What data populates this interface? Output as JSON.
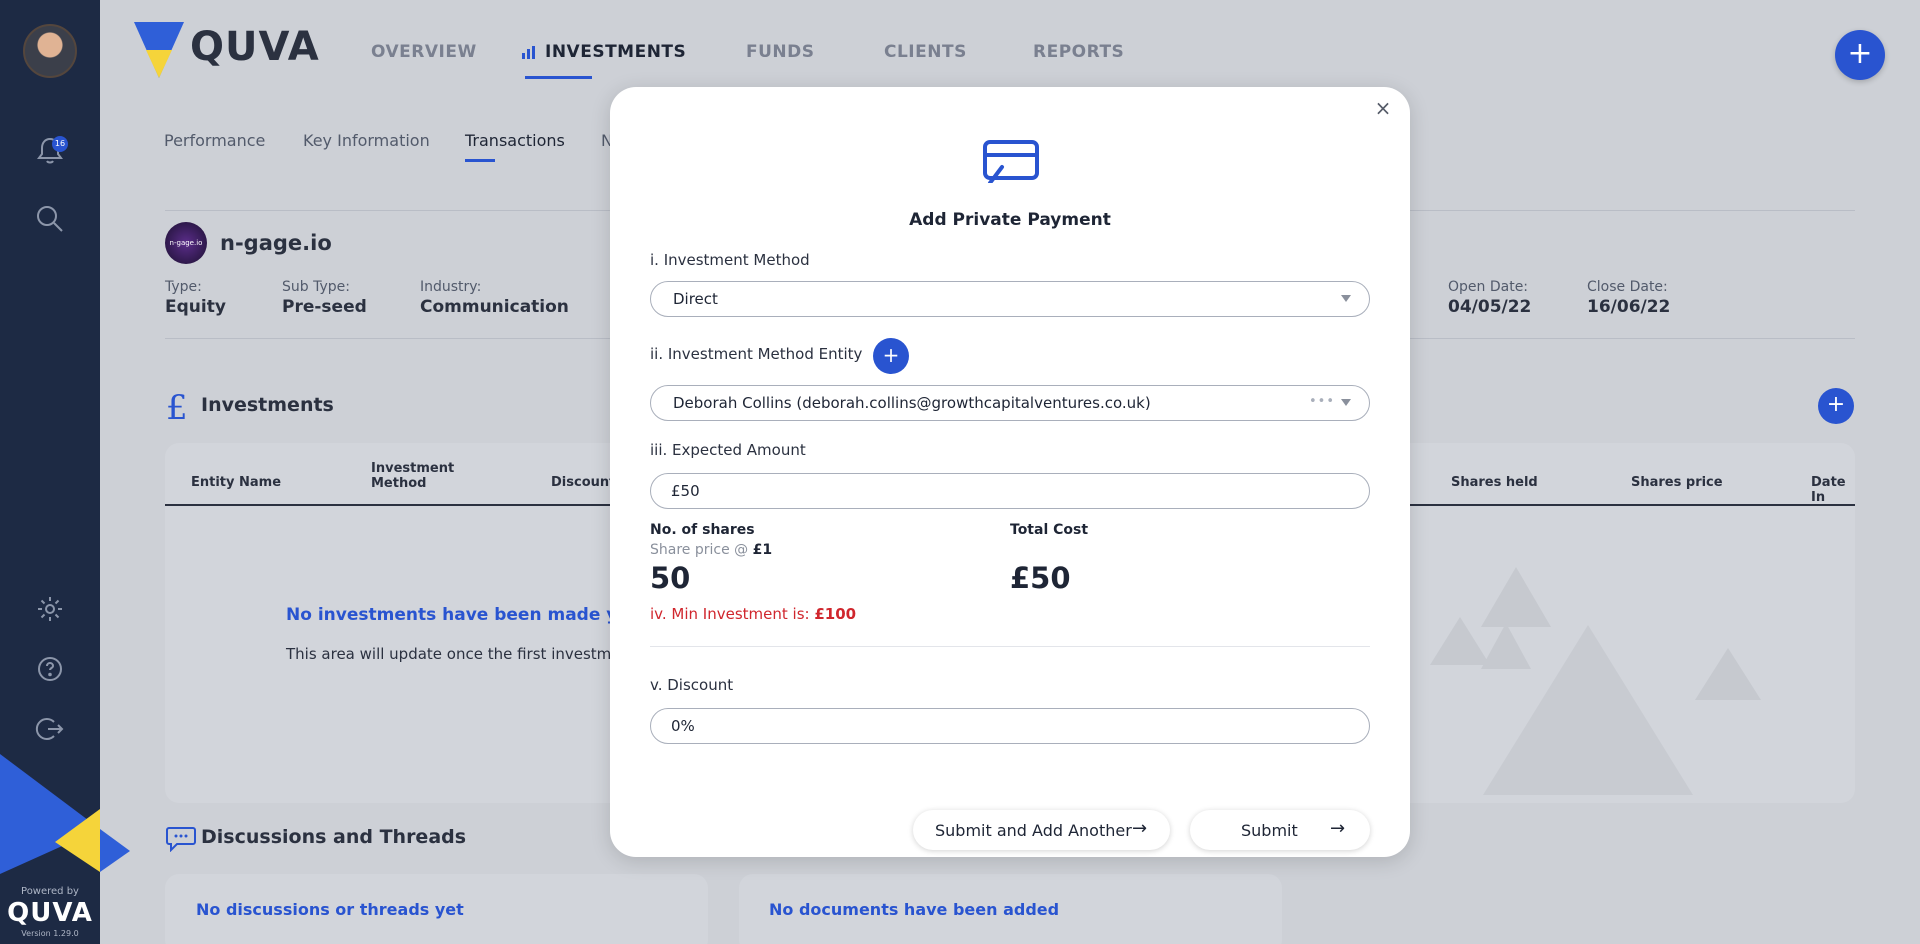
{
  "app": {
    "brand": "QUVA",
    "powered_by": "Powered by",
    "version": "Version 1.29.0"
  },
  "notifications": {
    "count": "16"
  },
  "topnav": {
    "overview": "OVERVIEW",
    "investments": "INVESTMENTS",
    "funds": "FUNDS",
    "clients": "CLIENTS",
    "reports": "REPORTS",
    "add": "+"
  },
  "subtabs": {
    "performance": "Performance",
    "key_information": "Key Information",
    "transactions": "Transactions",
    "partial": "N"
  },
  "company": {
    "logo_text": "n-gage.io",
    "name": "n-gage.io",
    "type_label": "Type:",
    "type": "Equity",
    "subtype_label": "Sub Type:",
    "subtype": "Pre-seed",
    "industry_label": "Industry:",
    "industry": "Communication",
    "open_label": "Open Date:",
    "open": "04/05/22",
    "close_label": "Close Date:",
    "close": "16/06/22"
  },
  "investments": {
    "icon": "£",
    "title": "Investments",
    "add": "+",
    "columns": [
      "Entity Name",
      "Investment Method",
      "Discount",
      "Shares held",
      "Shares price",
      "Date In"
    ],
    "empty_title": "No investments have been made yet",
    "empty_text": "This area will update once the first investment"
  },
  "discussions": {
    "title": "Discussions and Threads",
    "empty_title": "No discussions or threads yet",
    "docs_empty_title": "No documents have been added"
  },
  "modal": {
    "close": "×",
    "title": "Add Private Payment",
    "method_label": "i. Investment Method",
    "method_value": "Direct",
    "entity_label": "ii. Investment Method Entity",
    "entity_add": "+",
    "entity_value": "Deborah Collins (deborah.collins@growthcapitalventures.co.uk)",
    "amount_label": "iii. Expected Amount",
    "amount_value": "£50",
    "shares_label": "No. of shares",
    "share_price_prefix": "Share price @",
    "share_price": "£1",
    "shares_value": "50",
    "total_label": "Total Cost",
    "total_value": "£50",
    "min_prefix": "iv. Min Investment is:",
    "min_value": "£100",
    "discount_label": "v. Discount",
    "discount_value": "0%",
    "submit_another": "Submit and Add Another",
    "submit": "Submit",
    "arrow": "→"
  },
  "colors": {
    "sidebar": "#1d2a44",
    "accent": "#2954d0",
    "error": "#d0262d",
    "brand_yellow": "#f5d43a"
  }
}
